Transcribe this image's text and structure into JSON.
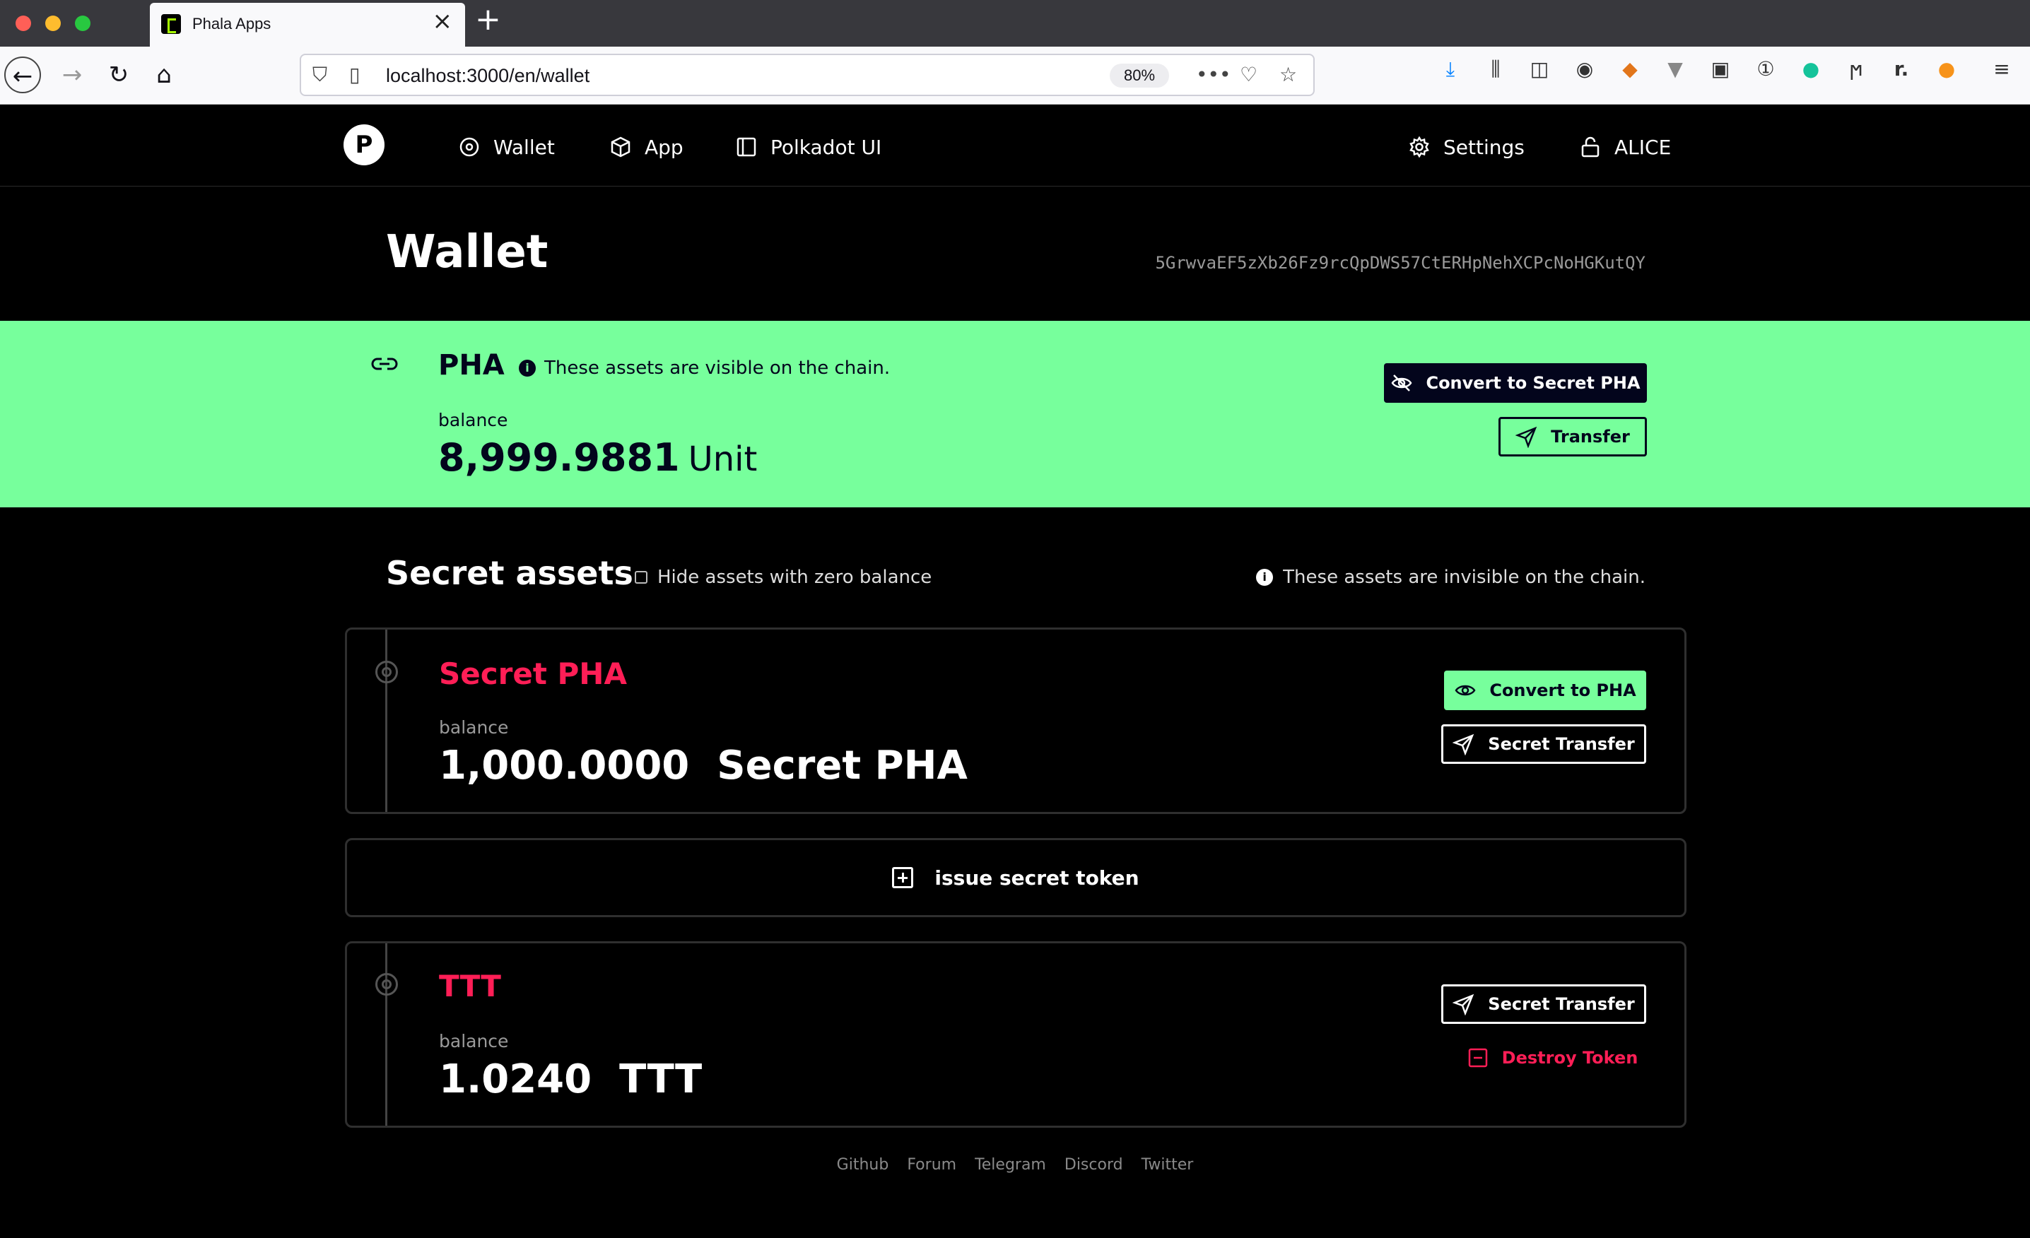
{
  "browser": {
    "tab_title": "Phala Apps",
    "url": "localhost:3000/en/wallet",
    "zoom": "80%",
    "traffic_colors": [
      "#ff5f57",
      "#febc2e",
      "#28c840"
    ]
  },
  "header": {
    "logo_letter": "P",
    "nav": [
      {
        "label": "Wallet",
        "icon": "circle-dot-icon"
      },
      {
        "label": "App",
        "icon": "cube-icon"
      },
      {
        "label": "Polkadot UI",
        "icon": "panel-icon"
      }
    ],
    "settings_label": "Settings",
    "account_label": "ALICE"
  },
  "wallet": {
    "title": "Wallet",
    "address": "5GrwvaEF5zXb26Fz9rcQpDWS57CtERHpNehXCPcNoHGKutQY"
  },
  "pha": {
    "name": "PHA",
    "note": "These assets are visible on the chain.",
    "balance_label": "balance",
    "balance": "8,999.9881",
    "unit": "Unit",
    "convert_label": "Convert to Secret PHA",
    "transfer_label": "Transfer",
    "accent": "#77ff9c"
  },
  "secret": {
    "title": "Secret assets",
    "hide_zero_label": "Hide assets with zero balance",
    "note": "These assets are invisible on the chain.",
    "issue_label": "issue secret token",
    "tokens": [
      {
        "name": "Secret PHA",
        "balance_label": "balance",
        "balance": "1,000.0000  Secret PHA",
        "primary_label": "Convert to PHA",
        "secondary_label": "Secret Transfer"
      },
      {
        "name": "TTT",
        "balance_label": "balance",
        "balance": "1.0240  TTT",
        "primary_label": "Secret Transfer",
        "secondary_label": "Destroy Token"
      }
    ],
    "token_color": "#ff1e56"
  },
  "footer": {
    "links": [
      "Github",
      "Forum",
      "Telegram",
      "Discord",
      "Twitter"
    ]
  }
}
